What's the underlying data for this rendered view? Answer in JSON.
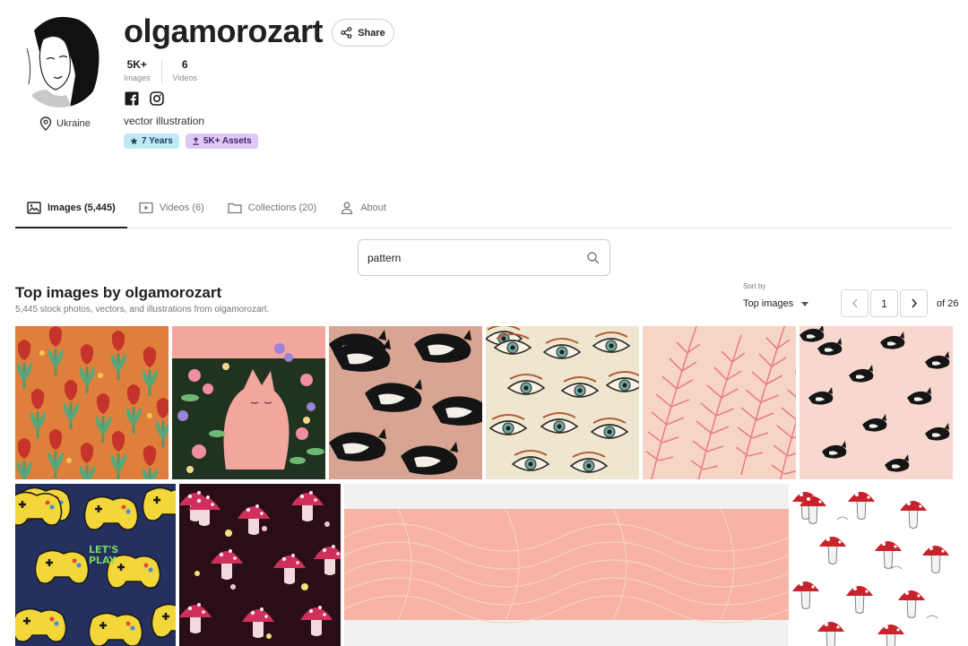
{
  "profile": {
    "username": "olgamorozart",
    "share_label": "Share",
    "location": "Ukraine",
    "stats": [
      {
        "value": "5K+",
        "label": "Images"
      },
      {
        "value": "6",
        "label": "Videos"
      }
    ],
    "socials": [
      "facebook-icon",
      "instagram-icon"
    ],
    "tagline": "vector illustration",
    "badges": {
      "years": "7 Years",
      "assets": "5K+ Assets"
    }
  },
  "tabs": [
    {
      "label": "Images (5,445)",
      "icon": "image-icon",
      "active": true
    },
    {
      "label": "Videos (6)",
      "icon": "video-icon",
      "active": false
    },
    {
      "label": "Collections (20)",
      "icon": "folder-icon",
      "active": false
    },
    {
      "label": "About",
      "icon": "person-icon",
      "active": false
    }
  ],
  "search": {
    "value": "pattern"
  },
  "section": {
    "title": "Top images by olgamorozart",
    "subtitle": "5,445 stock photos, vectors, and illustrations from olgamorozart."
  },
  "sort": {
    "label": "Sort by",
    "value": "Top images"
  },
  "pagination": {
    "current": "1",
    "total": "of 26"
  },
  "tiles": [
    {
      "subject": "tulip-pattern",
      "bg": "#e07f3c"
    },
    {
      "subject": "cat-in-flowers",
      "bg": "#1f3320"
    },
    {
      "subject": "black-white-cats-on-pink",
      "bg": "#d9a493"
    },
    {
      "subject": "eyes-pattern",
      "bg": "#efe6cf"
    },
    {
      "subject": "pink-palm-leaves",
      "bg": "#f6d5c6"
    },
    {
      "subject": "small-cats-on-pink",
      "bg": "#f8d7cf"
    },
    {
      "subject": "gamepads-lets-play",
      "bg": "#24305e",
      "text": "LET'S PLAY"
    },
    {
      "subject": "mushrooms-on-dark",
      "bg": "#2a0e17"
    },
    {
      "subject": "pink-wave-lines",
      "bg": "#f7b3a4"
    },
    {
      "subject": "fly-agaric-on-white",
      "bg": "#ffffff"
    }
  ]
}
